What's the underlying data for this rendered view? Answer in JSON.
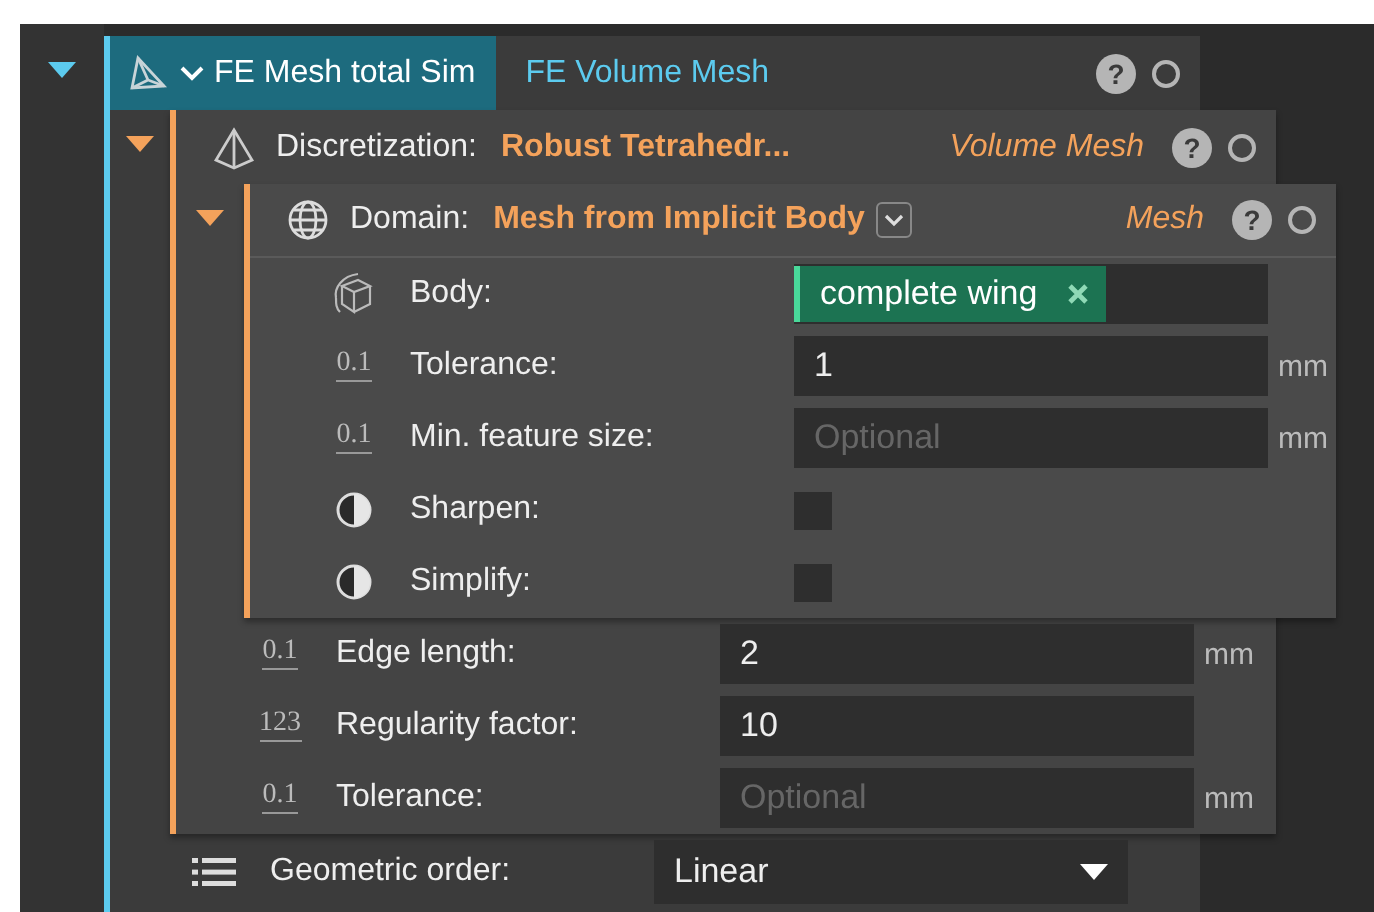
{
  "tree": {
    "kind": "simulation",
    "expanded": true,
    "selected": true,
    "color": "#5ccbef",
    "title": "FE Mesh total Sim",
    "type": "FE Volume Mesh",
    "help": "?",
    "rows": [
      {
        "kind": "discretization",
        "expanded": true,
        "selected": false,
        "color": "#f4a25b",
        "label": "Discretization:",
        "value": "Robust Tetrahedr...",
        "type": "Volume Mesh",
        "help": "?",
        "rows": [
          {
            "kind": "domain",
            "expanded": true,
            "selected": false,
            "color": "#f4a25b",
            "label": "Domain:",
            "value": "Mesh from Implicit Body",
            "type": "Mesh",
            "help": "?",
            "rows": [
              {
                "kind": "reference",
                "label": "Body:",
                "tag": "complete wing"
              },
              {
                "kind": "quantity",
                "icon_text": "0.1",
                "label": "Tolerance:",
                "value": "1",
                "unit": "mm"
              },
              {
                "kind": "quantity",
                "icon_text": "0.1",
                "label": "Min. feature size:",
                "placeholder": "Optional",
                "unit": "mm"
              },
              {
                "kind": "toggle",
                "label": "Sharpen:",
                "checked": false
              },
              {
                "kind": "toggle",
                "label": "Simplify:",
                "checked": false
              }
            ]
          },
          {
            "kind": "quantity",
            "icon_text": "0.1",
            "label": "Edge length:",
            "value": "2",
            "unit": "mm"
          },
          {
            "kind": "quantity",
            "icon_text": "123",
            "label": "Regularity factor:",
            "value": "10"
          },
          {
            "kind": "quantity",
            "icon_text": "0.1",
            "label": "Tolerance:",
            "placeholder": "Optional",
            "unit": "mm"
          }
        ]
      },
      {
        "kind": "choice",
        "label": "Geometric order:",
        "value": "Linear"
      }
    ]
  }
}
